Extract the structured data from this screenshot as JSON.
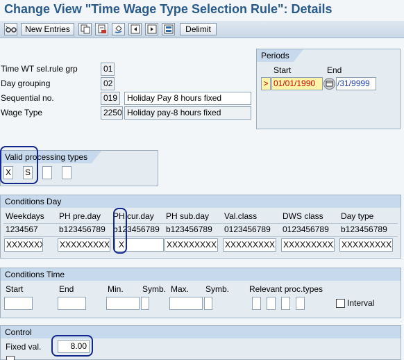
{
  "title": "Change View \"Time Wage Type Selection Rule\": Details",
  "toolbar": {
    "new_entries": "New Entries",
    "delimit": "Delimit",
    "icons": [
      "glasses-icon",
      "copy-icon",
      "delete-icon",
      "undo-icon",
      "prev-entry-icon",
      "next-entry-icon",
      "select-all-icon"
    ]
  },
  "header": {
    "rows": [
      {
        "label": "Time WT sel.rule grp",
        "value": "01"
      },
      {
        "label": "Day grouping",
        "value": "02"
      },
      {
        "label": "Sequential no.",
        "value": "019",
        "text": "Holiday Pay 8 hours fixed"
      },
      {
        "label": "Wage Type",
        "value": "2250",
        "text": "Holiday pay-8 hours fixed"
      }
    ]
  },
  "periods": {
    "title": "Periods",
    "start_label": "Start",
    "end_label": "End",
    "start": "01/01/1990",
    "end": "/31/9999"
  },
  "valid_proc": {
    "title": "Valid processing types",
    "values": [
      "X",
      "S",
      "",
      ""
    ]
  },
  "cond_day": {
    "title": "Conditions Day",
    "columns": [
      "Weekdays",
      "PH pre.day",
      "PH cur.day",
      "PH sub.day",
      "Val.class",
      "DWS class",
      "Day type"
    ],
    "patterns": [
      "1234567",
      "b123456789",
      "b123456789",
      "b123456789",
      "0123456789",
      "0123456789",
      "b123456789"
    ],
    "inputs": [
      "XXXXXXX",
      "XXXXXXXXXX",
      "X",
      "XXXXXXXXXX",
      "XXXXXXXXXX",
      "XXXXXXXXXX",
      "XXXXXXXXXX"
    ]
  },
  "cond_time": {
    "title": "Conditions Time",
    "labels": [
      "Start",
      "End",
      "Min.",
      "Symb.",
      "Max.",
      "Symb.",
      "Relevant proc.types"
    ],
    "interval_label": "Interval"
  },
  "control": {
    "title": "Control",
    "fixed_label": "Fixed val.",
    "fixed_value": "8.00"
  },
  "colors": {
    "title": "#2a5a8a",
    "highlight": "#14288c",
    "date_bg": "#fff4a8"
  }
}
